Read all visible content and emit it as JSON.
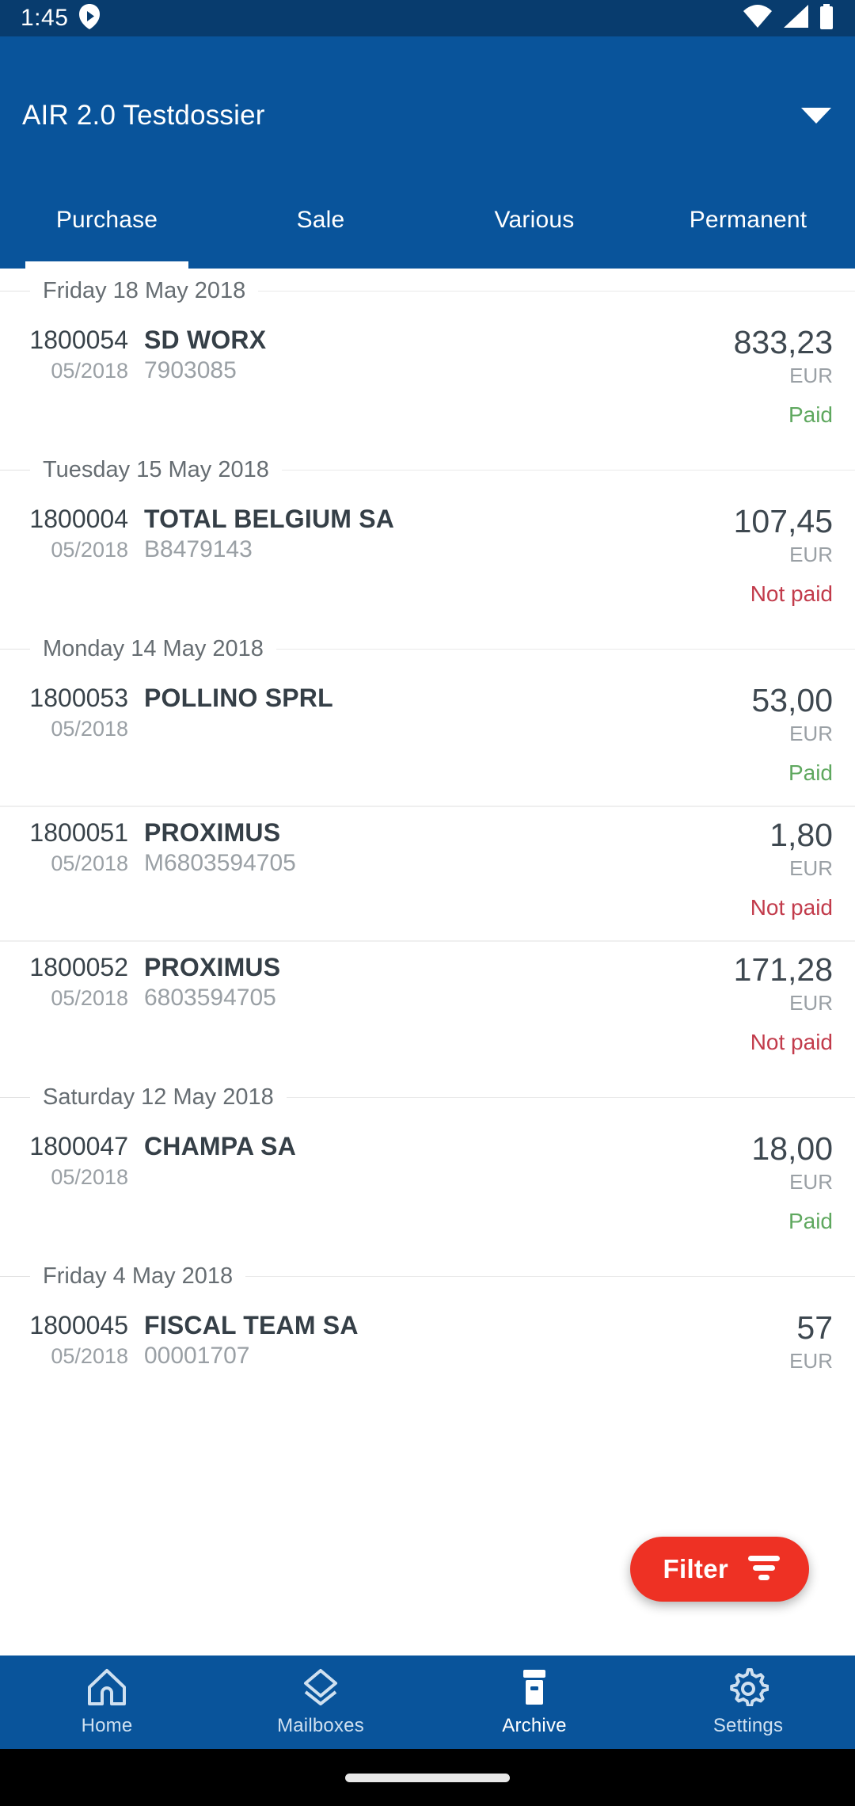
{
  "status_bar": {
    "time": "1:45",
    "left_icons": [
      "play-badge-icon"
    ],
    "right_icons": [
      "wifi-icon",
      "cellular-signal-icon",
      "battery-icon"
    ]
  },
  "app_bar": {
    "title": "AIR 2.0 Testdossier",
    "dropdown_icon": "chevron-down-icon",
    "background": "#09549b"
  },
  "tabs": [
    {
      "label": "Purchase",
      "active": true
    },
    {
      "label": "Sale",
      "active": false
    },
    {
      "label": "Various",
      "active": false
    },
    {
      "label": "Permanent",
      "active": false
    }
  ],
  "list": {
    "groups": [
      {
        "date": "Friday 18 May 2018",
        "rows": [
          {
            "doc_no": "1800054",
            "period": "05/2018",
            "party": "SD WORX",
            "reference": "7903085",
            "amount": "833,23",
            "currency": "EUR",
            "status": "Paid",
            "status_kind": "paid"
          }
        ]
      },
      {
        "date": "Tuesday 15 May 2018",
        "rows": [
          {
            "doc_no": "1800004",
            "period": "05/2018",
            "party": "TOTAL BELGIUM SA",
            "reference": "B8479143",
            "amount": "107,45",
            "currency": "EUR",
            "status": "Not paid",
            "status_kind": "notpaid"
          }
        ]
      },
      {
        "date": "Monday 14 May 2018",
        "rows": [
          {
            "doc_no": "1800053",
            "period": "05/2018",
            "party": "POLLINO SPRL",
            "reference": "",
            "amount": "53,00",
            "currency": "EUR",
            "status": "Paid",
            "status_kind": "paid"
          },
          {
            "doc_no": "1800051",
            "period": "05/2018",
            "party": "PROXIMUS",
            "reference": "M6803594705",
            "amount": "1,80",
            "currency": "EUR",
            "status": "Not paid",
            "status_kind": "notpaid"
          },
          {
            "doc_no": "1800052",
            "period": "05/2018",
            "party": "PROXIMUS",
            "reference": "6803594705",
            "amount": "171,28",
            "currency": "EUR",
            "status": "Not paid",
            "status_kind": "notpaid"
          }
        ]
      },
      {
        "date": "Saturday 12 May 2018",
        "rows": [
          {
            "doc_no": "1800047",
            "period": "05/2018",
            "party": "CHAMPA SA",
            "reference": "",
            "amount": "18,00",
            "currency": "EUR",
            "status": "Paid",
            "status_kind": "paid"
          }
        ]
      },
      {
        "date": "Friday 4 May 2018",
        "rows": [
          {
            "doc_no": "1800045",
            "period": "05/2018",
            "party": "FISCAL TEAM SA",
            "reference": "00001707",
            "amount": "57",
            "currency": "EUR",
            "status": "",
            "status_kind": "none"
          }
        ]
      }
    ]
  },
  "fab": {
    "label": "Filter",
    "icon": "filter-icon",
    "color": "#ee3124"
  },
  "bottom_nav": [
    {
      "label": "Home",
      "icon": "home-icon",
      "active": false
    },
    {
      "label": "Mailboxes",
      "icon": "layers-icon",
      "active": false
    },
    {
      "label": "Archive",
      "icon": "archive-icon",
      "active": true
    },
    {
      "label": "Settings",
      "icon": "gear-icon",
      "active": false
    }
  ],
  "colors": {
    "app_bar": "#09549b",
    "status_bar": "#083c6e",
    "paid": "#5fa85f",
    "not_paid": "#c23b4b",
    "accent_red": "#ee3124"
  }
}
